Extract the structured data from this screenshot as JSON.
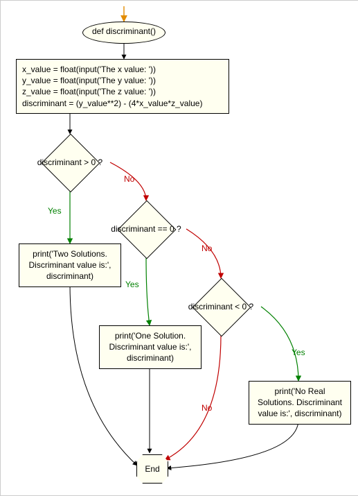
{
  "chart_data": {
    "type": "flowchart",
    "nodes": [
      {
        "id": "start",
        "kind": "terminator",
        "label": "def discriminant()"
      },
      {
        "id": "assign",
        "kind": "process",
        "lines": [
          "x_value = float(input('The x value: '))",
          "y_value = float(input('The y value: '))",
          "z_value = float(input('The z value: '))",
          "discriminant = (y_value**2) - (4*x_value*z_value)"
        ]
      },
      {
        "id": "d1",
        "kind": "decision",
        "label": "discriminant > 0 ?"
      },
      {
        "id": "d2",
        "kind": "decision",
        "label": "discriminant == 0 ?"
      },
      {
        "id": "d3",
        "kind": "decision",
        "label": "discriminant < 0 ?"
      },
      {
        "id": "p1",
        "kind": "process",
        "lines": [
          "print('Two Solutions.",
          "Discriminant value is:',",
          "discriminant)"
        ]
      },
      {
        "id": "p2",
        "kind": "process",
        "lines": [
          "print('One Solution.",
          "Discriminant value is:',",
          "discriminant)"
        ]
      },
      {
        "id": "p3",
        "kind": "process",
        "lines": [
          "print('No Real",
          "Solutions. Discriminant",
          "value is:', discriminant)"
        ]
      },
      {
        "id": "end",
        "kind": "terminator",
        "label": "End"
      }
    ],
    "edges": [
      {
        "from": "entry",
        "to": "start"
      },
      {
        "from": "start",
        "to": "assign"
      },
      {
        "from": "assign",
        "to": "d1"
      },
      {
        "from": "d1",
        "to": "p1",
        "label": "Yes"
      },
      {
        "from": "d1",
        "to": "d2",
        "label": "No"
      },
      {
        "from": "d2",
        "to": "p2",
        "label": "Yes"
      },
      {
        "from": "d2",
        "to": "d3",
        "label": "No"
      },
      {
        "from": "d3",
        "to": "p3",
        "label": "Yes"
      },
      {
        "from": "d3",
        "to": "end",
        "label": "No"
      },
      {
        "from": "p1",
        "to": "end"
      },
      {
        "from": "p2",
        "to": "end"
      },
      {
        "from": "p3",
        "to": "end"
      }
    ]
  },
  "labels": {
    "yes": "Yes",
    "no": "No",
    "end": "End"
  },
  "nodes": {
    "start": "def discriminant()",
    "assign_l1": "x_value = float(input('The x value: '))",
    "assign_l2": "y_value = float(input('The y value: '))",
    "assign_l3": "z_value = float(input('The z value: '))",
    "assign_l4": "discriminant = (y_value**2) - (4*x_value*z_value)",
    "d1": "discriminant > 0 ?",
    "d2": "discriminant == 0 ?",
    "d3": "discriminant < 0 ?",
    "p1_l1": "print('Two Solutions.",
    "p1_l2": "Discriminant value is:',",
    "p1_l3": "discriminant)",
    "p2_l1": "print('One Solution.",
    "p2_l2": "Discriminant value is:',",
    "p2_l3": "discriminant)",
    "p3_l1": "print('No Real",
    "p3_l2": "Solutions. Discriminant",
    "p3_l3": "value is:', discriminant)"
  }
}
